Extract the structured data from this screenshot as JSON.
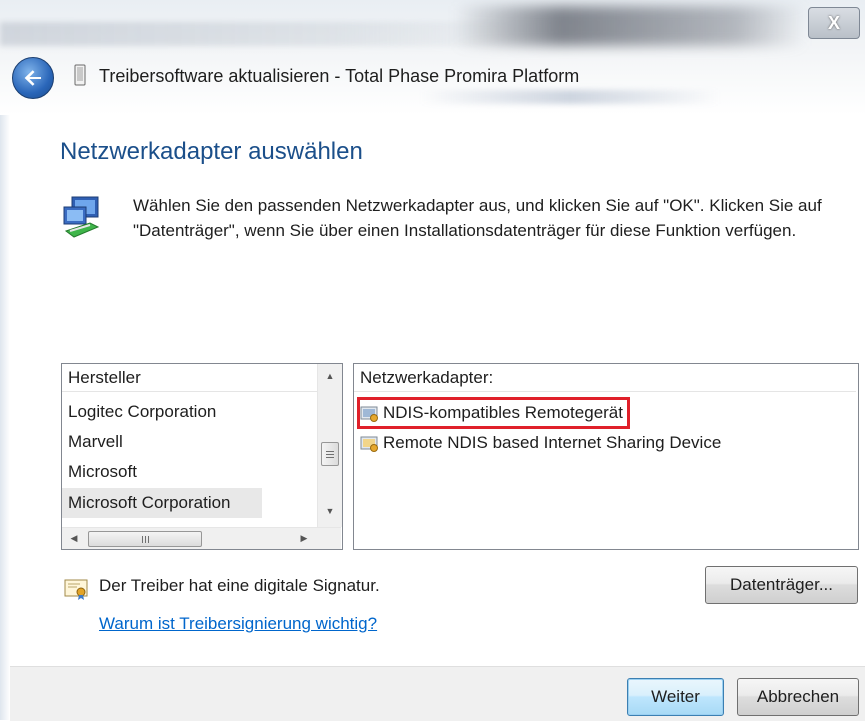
{
  "window": {
    "title": "Treibersoftware aktualisieren - Total Phase Promira Platform",
    "close_glyph": "X"
  },
  "page": {
    "heading": "Netzwerkadapter auswählen",
    "instructions": "Wählen Sie den passenden Netzwerkadapter aus, und klicken Sie auf \"OK\". Klicken Sie auf \"Datenträger\", wenn Sie über einen Installationsdatenträger für diese Funktion verfügen."
  },
  "manufacturer_list": {
    "header": "Hersteller",
    "items": [
      "Logitec Corporation",
      "Marvell",
      "Microsoft",
      "Microsoft Corporation"
    ],
    "selected": "Microsoft Corporation"
  },
  "adapter_list": {
    "header": "Netzwerkadapter:",
    "items": [
      "NDIS-kompatibles Remotegerät",
      "Remote NDIS based Internet Sharing Device"
    ],
    "highlighted": "NDIS-kompatibles Remotegerät",
    "highlight_color": "#e0202a"
  },
  "signature": {
    "text": "Der Treiber hat eine digitale Signatur.",
    "link": "Warum ist Treibersignierung wichtig?"
  },
  "buttons": {
    "disk": "Datenträger...",
    "next": "Weiter",
    "cancel": "Abbrechen"
  },
  "colors": {
    "heading": "#1b4f8a",
    "link": "#0066cc"
  },
  "icons": {
    "back": "back-arrow-icon",
    "device": "device-icon",
    "network": "network-adapter-icon",
    "certificate": "certificate-icon"
  }
}
